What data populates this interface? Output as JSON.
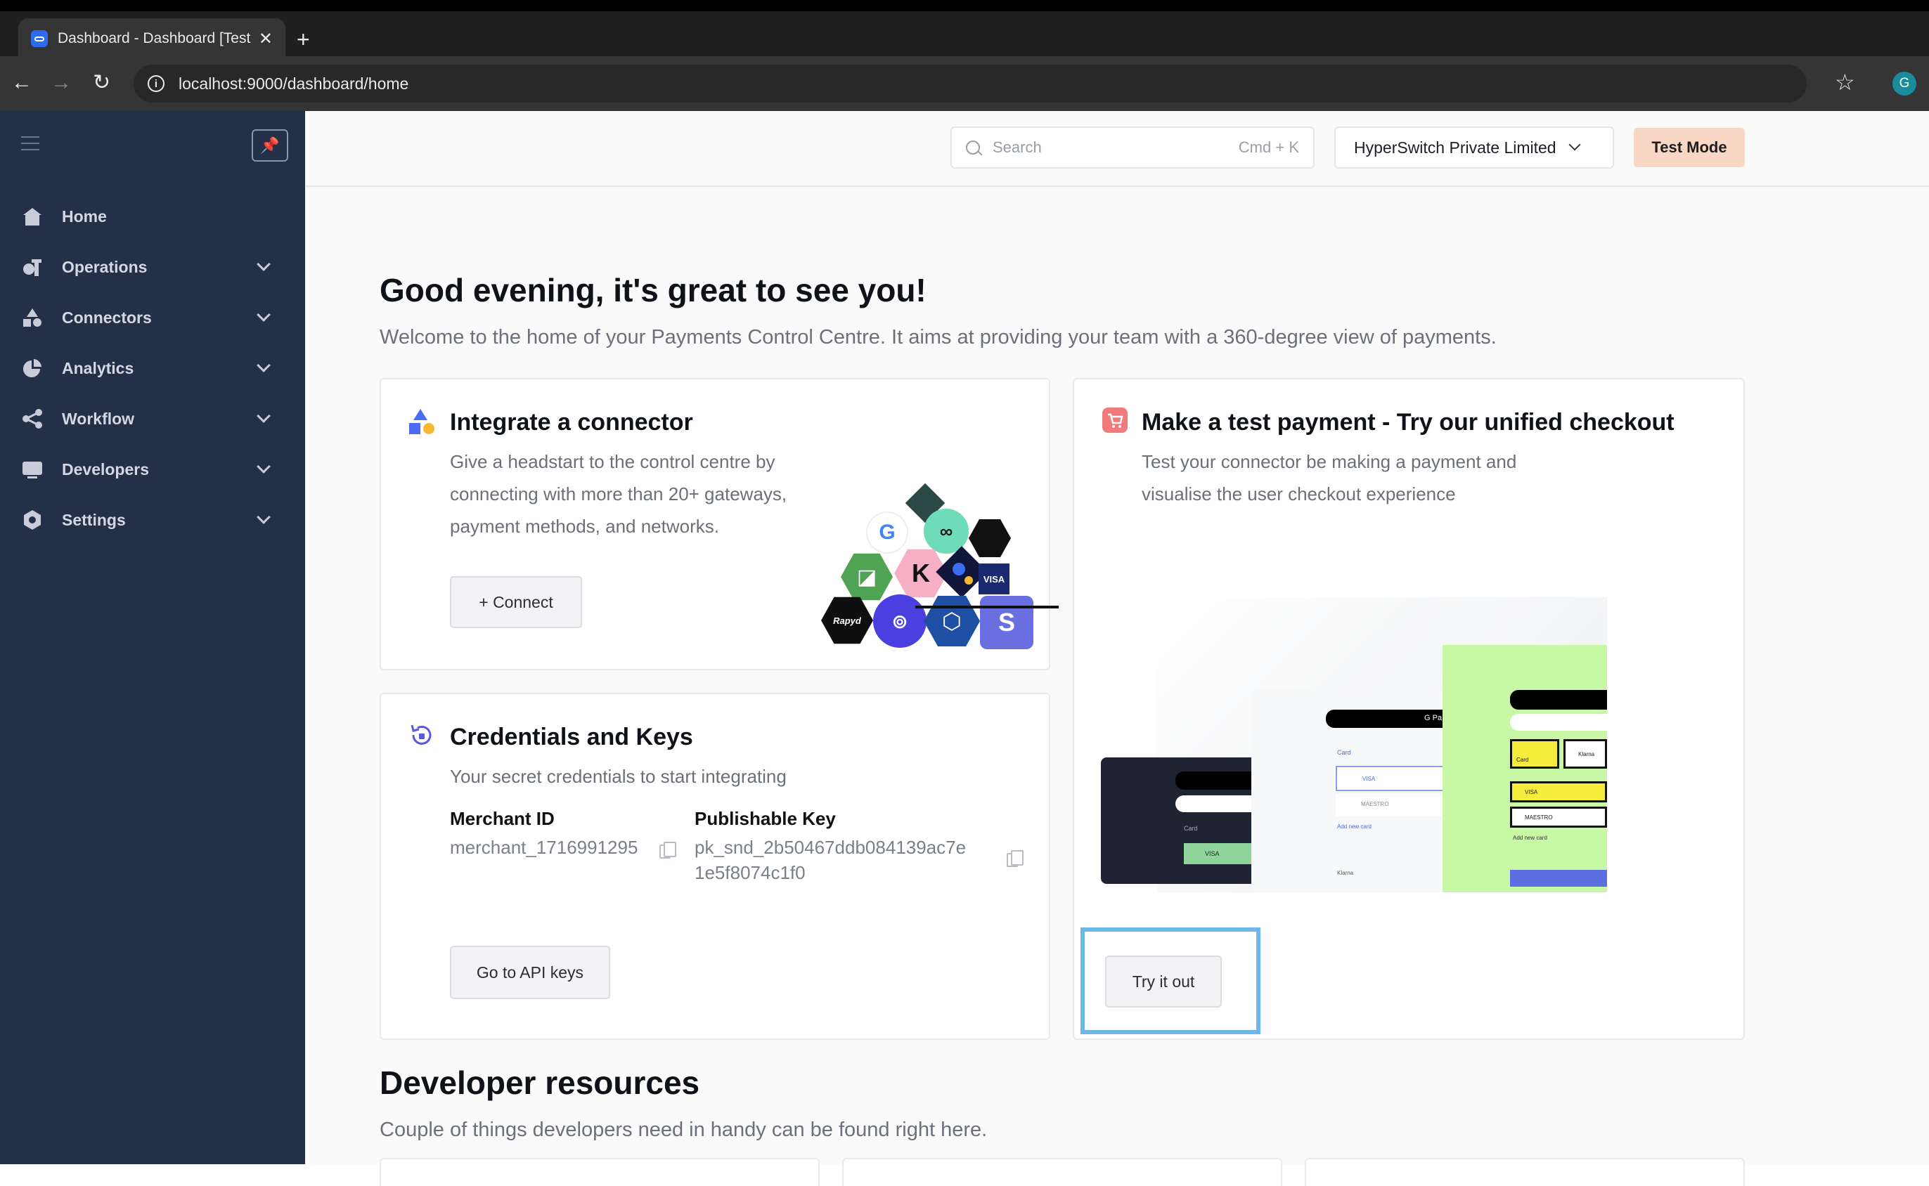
{
  "browser": {
    "tab_title": "Dashboard - Dashboard [Test",
    "url": "localhost:9000/dashboard/home",
    "profile_initial": "G"
  },
  "sidebar": {
    "items": [
      {
        "label": "Home",
        "icon": "home-icon",
        "expandable": false
      },
      {
        "label": "Operations",
        "icon": "operations-icon",
        "expandable": true
      },
      {
        "label": "Connectors",
        "icon": "connectors-icon",
        "expandable": true
      },
      {
        "label": "Analytics",
        "icon": "analytics-icon",
        "expandable": true
      },
      {
        "label": "Workflow",
        "icon": "workflow-icon",
        "expandable": true
      },
      {
        "label": "Developers",
        "icon": "developers-icon",
        "expandable": true
      },
      {
        "label": "Settings",
        "icon": "settings-icon",
        "expandable": true
      }
    ]
  },
  "topbar": {
    "search_placeholder": "Search",
    "search_shortcut": "Cmd + K",
    "merchant_name": "HyperSwitch Private Limited",
    "mode_badge": "Test Mode"
  },
  "home": {
    "greeting": "Good evening, it's great to see you!",
    "subtitle": "Welcome to the home of your Payments Control Centre. It aims at providing your team with a 360-degree view of payments."
  },
  "connector_card": {
    "title": "Integrate a connector",
    "description_lines": [
      "Give a headstart to the control centre by",
      "connecting with more than 20+ gateways,",
      "payment methods, and networks."
    ],
    "button": "+  Connect",
    "logos": {
      "rapyd": "Rapyd",
      "visa": "VISA",
      "klarna": "K",
      "stripe": "S"
    }
  },
  "checkout_card": {
    "title": "Make a test payment - Try our unified checkout",
    "description_lines": [
      "Test your connector be making a payment and",
      "visualise the user checkout experience"
    ],
    "button": "Try it out",
    "preview": {
      "card": "Card",
      "klarna": "Klarna",
      "visa": "VISA",
      "maestro": "MAESTRO",
      "add_new_card": "Add new card",
      "gpay": "G Pa"
    }
  },
  "credentials_card": {
    "title": "Credentials and Keys",
    "description": "Your secret credentials to start integrating",
    "merchant_id_label": "Merchant ID",
    "merchant_id": "merchant_1716991295",
    "publishable_key_label": "Publishable Key",
    "publishable_key_line1": "pk_snd_2b50467ddb084139ac7e",
    "publishable_key_line2": "1e5f8074c1f0",
    "button": "Go to API keys"
  },
  "developer_resources": {
    "title": "Developer resources",
    "subtitle": "Couple of things developers need in handy can be found right here."
  },
  "colors": {
    "sidebar_bg": "#242f48",
    "accent_test_mode": "#f8d7c4",
    "highlight": "#6fb6ea"
  }
}
